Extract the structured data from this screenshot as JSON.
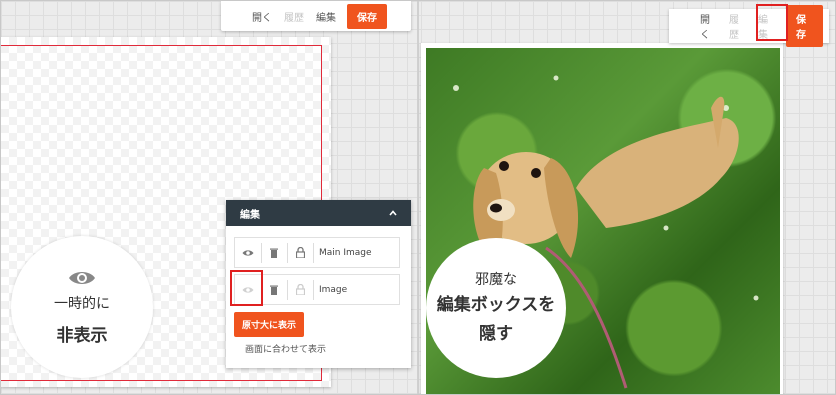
{
  "left_toolbar": {
    "open_label": "開く",
    "history_label": "履歴",
    "edit_label": "編集",
    "save_label": "保存"
  },
  "right_toolbar": {
    "open_label": "開く",
    "history_label": "履歴",
    "edit_label": "編集",
    "save_label": "保存"
  },
  "left_callout": {
    "line1": "一時的に",
    "line2": "非表示"
  },
  "edit_panel": {
    "title": "編集",
    "layers": [
      {
        "label": "Main Image",
        "visible": true
      },
      {
        "label": "Image",
        "visible": false
      }
    ],
    "actual_size_button": "原寸大に表示",
    "fit_screen_link": "画面に合わせて表示"
  },
  "right_callout": {
    "line1": "邪魔な",
    "line2": "編集ボックスを",
    "line3": "隠す"
  },
  "colors": {
    "accent": "#f0541e",
    "panel_header": "#2f3b44",
    "highlight": "#e02020"
  }
}
